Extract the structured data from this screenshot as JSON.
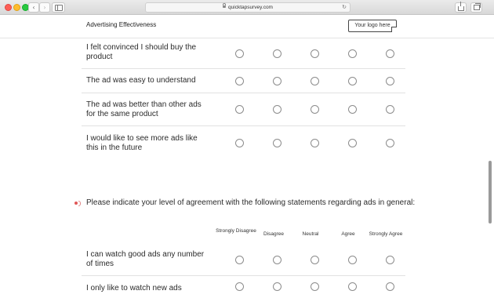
{
  "browser": {
    "url": "quicktapsurvey.com",
    "icons": [
      "back-icon",
      "forward-icon",
      "sidebar-icon",
      "lock-icon",
      "reload-icon",
      "share-icon",
      "tabs-icon"
    ]
  },
  "header": {
    "title": "Advertising Effectiveness",
    "logo_text": "Your logo here"
  },
  "question1": {
    "rows": [
      {
        "label": "I felt convinced I should buy the product"
      },
      {
        "label": "The ad was easy to understand"
      },
      {
        "label": "The ad was better than other ads for the same product"
      },
      {
        "label": "I would like to see more ads like this in the future"
      }
    ]
  },
  "question2": {
    "title": "Please indicate your level of agreement with the following statements regarding ads in general:",
    "columns": [
      "Strongly Disagree",
      "Disagree",
      "Neutral",
      "Agree",
      "Strongly Agree"
    ],
    "rows": [
      {
        "label": "I can watch good ads any number of times"
      },
      {
        "label": "I only like to watch new ads"
      }
    ]
  }
}
